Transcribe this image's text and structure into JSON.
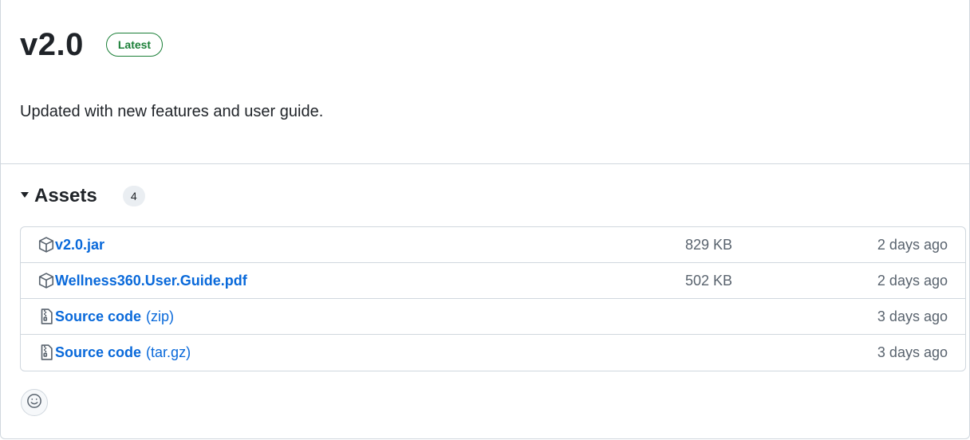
{
  "release": {
    "version": "v2.0",
    "badge": "Latest",
    "description": "Updated with new features and user guide."
  },
  "assets": {
    "caret_icon": "triangle-down-icon",
    "title": "Assets",
    "count": "4",
    "items": [
      {
        "icon": "package-icon",
        "name": "v2.0.jar",
        "suffix": "",
        "size": "829 KB",
        "date": "2 days ago"
      },
      {
        "icon": "package-icon",
        "name": "Wellness360.User.Guide.pdf",
        "suffix": "",
        "size": "502 KB",
        "date": "2 days ago"
      },
      {
        "icon": "file-zip-icon",
        "name": "Source code",
        "suffix": "(zip)",
        "size": "",
        "date": "3 days ago"
      },
      {
        "icon": "file-zip-icon",
        "name": "Source code",
        "suffix": "(tar.gz)",
        "size": "",
        "date": "3 days ago"
      }
    ]
  },
  "reactions": {
    "icon": "smiley-icon"
  },
  "colors": {
    "accent": "#0969da",
    "success": "#1a7f37",
    "muted": "#59636e",
    "border": "#d0d7de"
  }
}
